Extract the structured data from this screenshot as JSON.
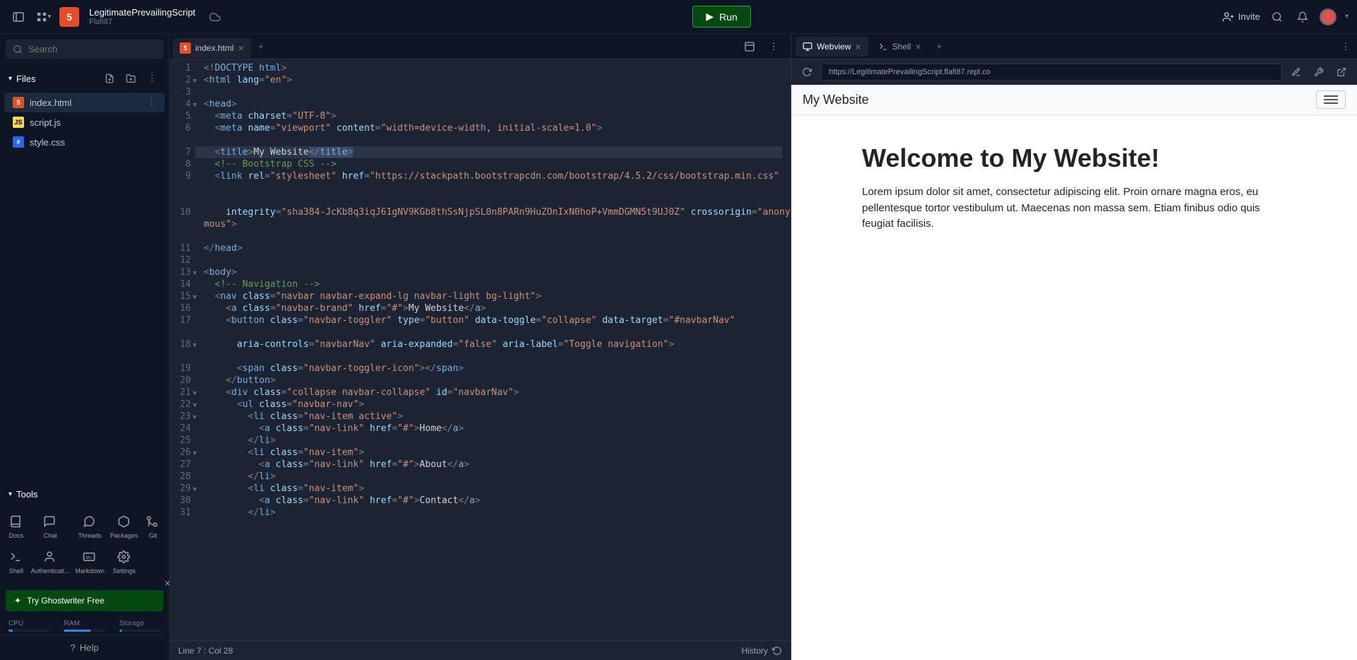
{
  "header": {
    "project_name": "LegitimatePrevailingScript",
    "owner": "Flafi87",
    "run_label": "Run",
    "invite_label": "Invite"
  },
  "sidebar": {
    "search_placeholder": "Search",
    "files_label": "Files",
    "files": [
      {
        "name": "index.html",
        "type": "html"
      },
      {
        "name": "script.js",
        "type": "js"
      },
      {
        "name": "style.css",
        "type": "css"
      }
    ],
    "tools_label": "Tools",
    "tools": [
      "Docs",
      "Chat",
      "Threads",
      "Packages",
      "Git",
      "Shell",
      "Authenticati...",
      "Markdown",
      "Settings"
    ],
    "ghost_label": "Try Ghostwriter Free",
    "resources": {
      "cpu": "CPU",
      "ram": "RAM",
      "storage": "Storage"
    },
    "help_label": "Help"
  },
  "editor": {
    "tab_label": "index.html",
    "status_left": "Line 7 : Col 28",
    "status_right": "History",
    "code_lines": [
      {
        "n": 1,
        "html": "<span class='tk-punct'>&lt;!</span><span class='tk-doctype'>DOCTYPE html</span><span class='tk-punct'>&gt;</span>"
      },
      {
        "n": 2,
        "fold": true,
        "html": "<span class='tk-punct'>&lt;</span><span class='tk-tag'>html</span> <span class='tk-attr'>lang</span><span class='tk-punct'>=</span><span class='tk-str'>\"en\"</span><span class='tk-punct'>&gt;</span>"
      },
      {
        "n": 3,
        "html": ""
      },
      {
        "n": 4,
        "fold": true,
        "html": "<span class='tk-punct'>&lt;</span><span class='tk-tag'>head</span><span class='tk-punct'>&gt;</span>"
      },
      {
        "n": 5,
        "html": "  <span class='tk-punct'>&lt;</span><span class='tk-tag'>meta</span> <span class='tk-attr'>charset</span><span class='tk-punct'>=</span><span class='tk-str'>\"UTF-8\"</span><span class='tk-punct'>&gt;</span>"
      },
      {
        "n": 6,
        "html": "  <span class='tk-punct'>&lt;</span><span class='tk-tag'>meta</span> <span class='tk-attr'>name</span><span class='tk-punct'>=</span><span class='tk-str'>\"viewport\"</span> <span class='tk-attr'>content</span><span class='tk-punct'>=</span><span class='tk-str'>\"width=device-width, initial-scale=1.0\"</span><span class='tk-punct'>&gt;</span>"
      },
      {
        "n": 7,
        "hl": true,
        "html": "  <span class='tk-punct'>&lt;</span><span class='tk-tag'>title</span><span class='tk-punct'>&gt;</span><span class='tk-text'>My Website</span><span class='sel'><span class='tk-punct'>&lt;/</span><span class='tk-tag'>title</span><span class='tk-punct'>&gt;</span></span>"
      },
      {
        "n": 8,
        "html": "  <span class='tk-comment'>&lt;!-- Bootstrap CSS --&gt;</span>"
      },
      {
        "n": 9,
        "html": "  <span class='tk-punct'>&lt;</span><span class='tk-tag'>link</span> <span class='tk-attr'>rel</span><span class='tk-punct'>=</span><span class='tk-str'>\"stylesheet\"</span> <span class='tk-attr'>href</span><span class='tk-punct'>=</span><span class='tk-str'>\"https://stackpath.bootstrapcdn.com/bootstrap/4.5.2/css/bootstrap.min.css\"</span>"
      },
      {
        "n": 10,
        "html": "    <span class='tk-attr'>integrity</span><span class='tk-punct'>=</span><span class='tk-str'>\"sha384-JcKb8q3iqJ61gNV9KGb8thSsNjpSL0n8PARn9HuZOnIxN0hoP+VmmDGMN5t9UJ0Z\"</span> <span class='tk-attr'>crossorigin</span><span class='tk-punct'>=</span><span class='tk-str'>\"anonymous\"</span><span class='tk-punct'>&gt;</span>"
      },
      {
        "n": 11,
        "html": "<span class='tk-punct'>&lt;/</span><span class='tk-tag'>head</span><span class='tk-punct'>&gt;</span>"
      },
      {
        "n": 12,
        "html": ""
      },
      {
        "n": 13,
        "fold": true,
        "html": "<span class='tk-punct'>&lt;</span><span class='tk-tag'>body</span><span class='tk-punct'>&gt;</span>"
      },
      {
        "n": 14,
        "html": "  <span class='tk-comment'>&lt;!-- Navigation --&gt;</span>"
      },
      {
        "n": 15,
        "fold": true,
        "html": "  <span class='tk-punct'>&lt;</span><span class='tk-tag'>nav</span> <span class='tk-attr'>class</span><span class='tk-punct'>=</span><span class='tk-str'>\"navbar navbar-expand-lg navbar-light bg-light\"</span><span class='tk-punct'>&gt;</span>"
      },
      {
        "n": 16,
        "html": "    <span class='tk-punct'>&lt;</span><span class='tk-tag'>a</span> <span class='tk-attr'>class</span><span class='tk-punct'>=</span><span class='tk-str'>\"navbar-brand\"</span> <span class='tk-attr'>href</span><span class='tk-punct'>=</span><span class='tk-str'>\"#\"</span><span class='tk-punct'>&gt;</span><span class='tk-text'>My Website</span><span class='tk-punct'>&lt;/</span><span class='tk-tag'>a</span><span class='tk-punct'>&gt;</span>"
      },
      {
        "n": 17,
        "html": "    <span class='tk-punct'>&lt;</span><span class='tk-tag'>button</span> <span class='tk-attr'>class</span><span class='tk-punct'>=</span><span class='tk-str'>\"navbar-toggler\"</span> <span class='tk-attr'>type</span><span class='tk-punct'>=</span><span class='tk-str'>\"button\"</span> <span class='tk-attr'>data-toggle</span><span class='tk-punct'>=</span><span class='tk-str'>\"collapse\"</span> <span class='tk-attr'>data-target</span><span class='tk-punct'>=</span><span class='tk-str'>\"#navbarNav\"</span>"
      },
      {
        "n": 18,
        "fold": true,
        "html": "      <span class='tk-attr'>aria-controls</span><span class='tk-punct'>=</span><span class='tk-str'>\"navbarNav\"</span> <span class='tk-attr'>aria-expanded</span><span class='tk-punct'>=</span><span class='tk-str'>\"false\"</span> <span class='tk-attr'>aria-label</span><span class='tk-punct'>=</span><span class='tk-str'>\"Toggle navigation\"</span><span class='tk-punct'>&gt;</span>"
      },
      {
        "n": 19,
        "html": "      <span class='tk-punct'>&lt;</span><span class='tk-tag'>span</span> <span class='tk-attr'>class</span><span class='tk-punct'>=</span><span class='tk-str'>\"navbar-toggler-icon\"</span><span class='tk-punct'>&gt;&lt;/</span><span class='tk-tag'>span</span><span class='tk-punct'>&gt;</span>"
      },
      {
        "n": 20,
        "html": "    <span class='tk-punct'>&lt;/</span><span class='tk-tag'>button</span><span class='tk-punct'>&gt;</span>"
      },
      {
        "n": 21,
        "fold": true,
        "html": "    <span class='tk-punct'>&lt;</span><span class='tk-tag'>div</span> <span class='tk-attr'>class</span><span class='tk-punct'>=</span><span class='tk-str'>\"collapse navbar-collapse\"</span> <span class='tk-attr'>id</span><span class='tk-punct'>=</span><span class='tk-str'>\"navbarNav\"</span><span class='tk-punct'>&gt;</span>"
      },
      {
        "n": 22,
        "fold": true,
        "html": "      <span class='tk-punct'>&lt;</span><span class='tk-tag'>ul</span> <span class='tk-attr'>class</span><span class='tk-punct'>=</span><span class='tk-str'>\"navbar-nav\"</span><span class='tk-punct'>&gt;</span>"
      },
      {
        "n": 23,
        "fold": true,
        "html": "        <span class='tk-punct'>&lt;</span><span class='tk-tag'>li</span> <span class='tk-attr'>class</span><span class='tk-punct'>=</span><span class='tk-str'>\"nav-item active\"</span><span class='tk-punct'>&gt;</span>"
      },
      {
        "n": 24,
        "html": "          <span class='tk-punct'>&lt;</span><span class='tk-tag'>a</span> <span class='tk-attr'>class</span><span class='tk-punct'>=</span><span class='tk-str'>\"nav-link\"</span> <span class='tk-attr'>href</span><span class='tk-punct'>=</span><span class='tk-str'>\"#\"</span><span class='tk-punct'>&gt;</span><span class='tk-text'>Home</span><span class='tk-punct'>&lt;/</span><span class='tk-tag'>a</span><span class='tk-punct'>&gt;</span>"
      },
      {
        "n": 25,
        "html": "        <span class='tk-punct'>&lt;/</span><span class='tk-tag'>li</span><span class='tk-punct'>&gt;</span>"
      },
      {
        "n": 26,
        "fold": true,
        "html": "        <span class='tk-punct'>&lt;</span><span class='tk-tag'>li</span> <span class='tk-attr'>class</span><span class='tk-punct'>=</span><span class='tk-str'>\"nav-item\"</span><span class='tk-punct'>&gt;</span>"
      },
      {
        "n": 27,
        "html": "          <span class='tk-punct'>&lt;</span><span class='tk-tag'>a</span> <span class='tk-attr'>class</span><span class='tk-punct'>=</span><span class='tk-str'>\"nav-link\"</span> <span class='tk-attr'>href</span><span class='tk-punct'>=</span><span class='tk-str'>\"#\"</span><span class='tk-punct'>&gt;</span><span class='tk-text'>About</span><span class='tk-punct'>&lt;/</span><span class='tk-tag'>a</span><span class='tk-punct'>&gt;</span>"
      },
      {
        "n": 28,
        "html": "        <span class='tk-punct'>&lt;/</span><span class='tk-tag'>li</span><span class='tk-punct'>&gt;</span>"
      },
      {
        "n": 29,
        "fold": true,
        "html": "        <span class='tk-punct'>&lt;</span><span class='tk-tag'>li</span> <span class='tk-attr'>class</span><span class='tk-punct'>=</span><span class='tk-str'>\"nav-item\"</span><span class='tk-punct'>&gt;</span>"
      },
      {
        "n": 30,
        "html": "          <span class='tk-punct'>&lt;</span><span class='tk-tag'>a</span> <span class='tk-attr'>class</span><span class='tk-punct'>=</span><span class='tk-str'>\"nav-link\"</span> <span class='tk-attr'>href</span><span class='tk-punct'>=</span><span class='tk-str'>\"#\"</span><span class='tk-punct'>&gt;</span><span class='tk-text'>Contact</span><span class='tk-punct'>&lt;/</span><span class='tk-tag'>a</span><span class='tk-punct'>&gt;</span>"
      },
      {
        "n": 31,
        "html": "        <span class='tk-punct'>&lt;/</span><span class='tk-tag'>li</span><span class='tk-punct'>&gt;</span>"
      }
    ]
  },
  "preview": {
    "tabs": {
      "webview": "Webview",
      "shell": "Shell"
    },
    "url": "https://LegitimatePrevailingScript.flafi87.repl.co",
    "brand": "My Website",
    "heading": "Welcome to My Website!",
    "body_text": "Lorem ipsum dolor sit amet, consectetur adipiscing elit. Proin ornare magna eros, eu pellentesque tortor vestibulum ut. Maecenas non massa sem. Etiam finibus odio quis feugiat facilisis."
  }
}
